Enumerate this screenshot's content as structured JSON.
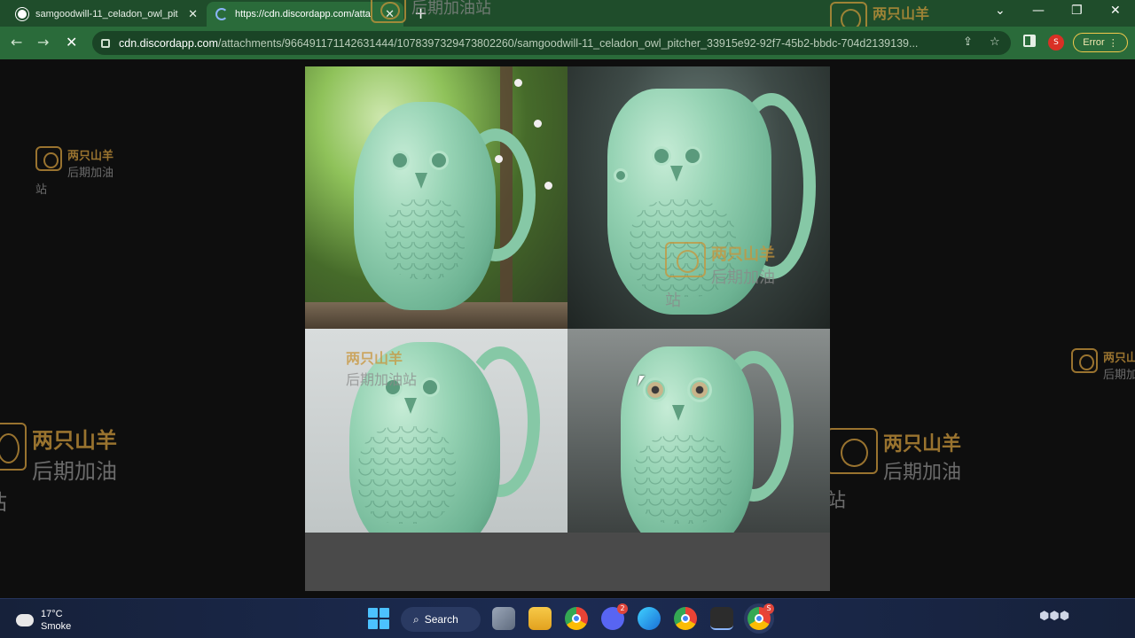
{
  "browser": {
    "tabs": [
      {
        "title": "samgoodwill-11_celadon_owl_pit",
        "state": "inactive",
        "icon": "globe-icon"
      },
      {
        "title": "https://cdn.discordapp.com/atta",
        "state": "active",
        "icon": "loading-spinner-icon"
      }
    ],
    "new_tab_glyph": "+",
    "window_controls": {
      "tab_search": "⌄",
      "minimize": "—",
      "restore": "❐",
      "close": "✕"
    },
    "nav": {
      "back": "←",
      "forward": "→",
      "stop": "✕"
    },
    "address_bar": {
      "host": "cdn.discordapp.com",
      "path": "/attachments/966491171142631444/1078397329473802260/samgoodwill-11_celadon_owl_pitcher_33915e92-92f7-45b2-bbdc-704d2139139..."
    },
    "profile_initial": "S",
    "error_label": "Error",
    "error_chevron": "⋮"
  },
  "watermark": {
    "line1": "两只山羊",
    "line2": "后期加油站"
  },
  "taskbar": {
    "weather": {
      "temp": "17°C",
      "condition": "Smoke"
    },
    "search_label": "Search",
    "badges": {
      "discord": "2",
      "chrome_active": "S"
    }
  },
  "colors": {
    "tab_strip": "#1f4d2b",
    "toolbar": "#2a6b3a",
    "omnibox": "#1a4426",
    "page_background": "#0e0e0e",
    "image_frame": "#4a4a4a",
    "celadon": "#96d3b4",
    "watermark_gold": "#c8953a",
    "taskbar": "#1c2b52"
  }
}
